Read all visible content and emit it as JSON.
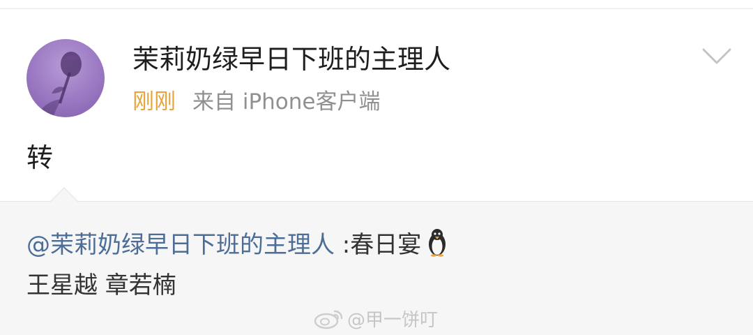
{
  "post": {
    "author": {
      "name": "茉莉奶绿早日下班的主理人",
      "avatar_icon": "rose-avatar-icon"
    },
    "meta": {
      "time": "刚刚",
      "source": "来自 iPhone客户端"
    },
    "text": "转",
    "menu_icon": "chevron-down-icon"
  },
  "repost": {
    "mention": "@茉莉奶绿早日下班的主理人",
    "content": " :春日宴",
    "emoji": "penguin-icon",
    "line2": "王星越 章若楠"
  },
  "watermark": {
    "text": "@甲一饼叮",
    "logo_icon": "weibo-logo-icon"
  },
  "colors": {
    "time": "#e8a33a",
    "source": "#909090",
    "mention": "#4c6d98",
    "repost_bg": "#f6f6f6",
    "avatar": "#9a78c2"
  }
}
